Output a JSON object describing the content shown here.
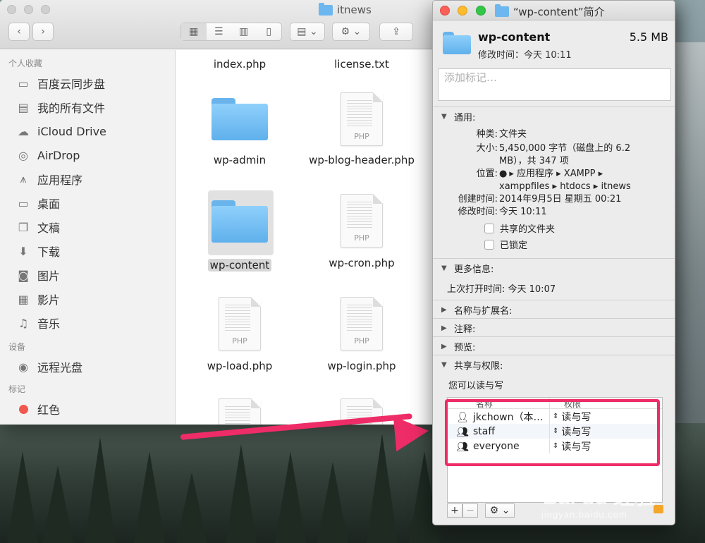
{
  "finder": {
    "title": "itnews",
    "sidebar": {
      "favorites_header": "个人收藏",
      "favorites": [
        {
          "label": "百度云同步盘",
          "icon": "folder-icon"
        },
        {
          "label": "我的所有文件",
          "icon": "all-files-icon"
        },
        {
          "label": "iCloud Drive",
          "icon": "cloud-icon"
        },
        {
          "label": "AirDrop",
          "icon": "airdrop-icon"
        },
        {
          "label": "应用程序",
          "icon": "applications-icon"
        },
        {
          "label": "桌面",
          "icon": "desktop-icon"
        },
        {
          "label": "文稿",
          "icon": "documents-icon"
        },
        {
          "label": "下载",
          "icon": "downloads-icon"
        },
        {
          "label": "图片",
          "icon": "camera-icon"
        },
        {
          "label": "影片",
          "icon": "film-icon"
        },
        {
          "label": "音乐",
          "icon": "music-icon"
        }
      ],
      "devices_header": "设备",
      "devices": [
        {
          "label": "远程光盘",
          "icon": "disc-icon"
        }
      ],
      "tags_header": "标记",
      "tags": [
        {
          "label": "红色",
          "color": "#f0584e"
        }
      ]
    },
    "files": [
      {
        "name": "index.php",
        "type": "php"
      },
      {
        "name": "license.txt",
        "type": "txt"
      },
      {
        "name": "wp-admin",
        "type": "folder"
      },
      {
        "name": "wp-blog-header.php",
        "type": "php"
      },
      {
        "name": "wp-content",
        "type": "folder",
        "selected": true
      },
      {
        "name": "wp-cron.php",
        "type": "php"
      },
      {
        "name": "wp-load.php",
        "type": "php"
      },
      {
        "name": "wp-login.php",
        "type": "php"
      }
    ],
    "php_ext_label": "PHP"
  },
  "info": {
    "title": "“wp-content”简介",
    "name": "wp-content",
    "size": "5.5 MB",
    "modified": "修改时间：今天 10:11",
    "tags_placeholder": "添加标记…",
    "general": {
      "header": "通用:",
      "kind_k": "种类:",
      "kind_v": "文件夹",
      "size_k": "大小:",
      "size_v1": "5,450,000 字节（磁盘上的 6.2",
      "size_v2": "MB），共 347 项",
      "where_k": "位置:",
      "where_v1": "▸ 应用程序 ▸ XAMPP ▸",
      "where_v2": "xamppfiles ▸ htdocs ▸ itnews",
      "created_k": "创建时间:",
      "created_v": "2014年9月5日 星期五 00:21",
      "modified_k": "修改时间:",
      "modified_v": "今天 10:11",
      "shared_label": "共享的文件夹",
      "locked_label": "已锁定"
    },
    "more": {
      "header": "更多信息:",
      "last_opened": "上次打开时间: 今天 10:07"
    },
    "name_ext_header": "名称与扩展名:",
    "comments_header": "注释:",
    "preview_header": "预览:",
    "sharing": {
      "header": "共享与权限:",
      "status": "您可以读与写",
      "col_name": "名称",
      "col_priv": "权限",
      "rows": [
        {
          "user": "jkchown（本…",
          "priv": "读与写",
          "icon": "single-user-icon"
        },
        {
          "user": "staff",
          "priv": "读与写",
          "icon": "group-icon"
        },
        {
          "user": "everyone",
          "priv": "读与写",
          "icon": "everyone-icon"
        }
      ],
      "add_label": "+",
      "remove_label": "−",
      "action_label": "⚙︎ ⌄"
    }
  },
  "watermark": {
    "brand": "Bai du 经验",
    "site": "jingyan.baidu.com"
  }
}
